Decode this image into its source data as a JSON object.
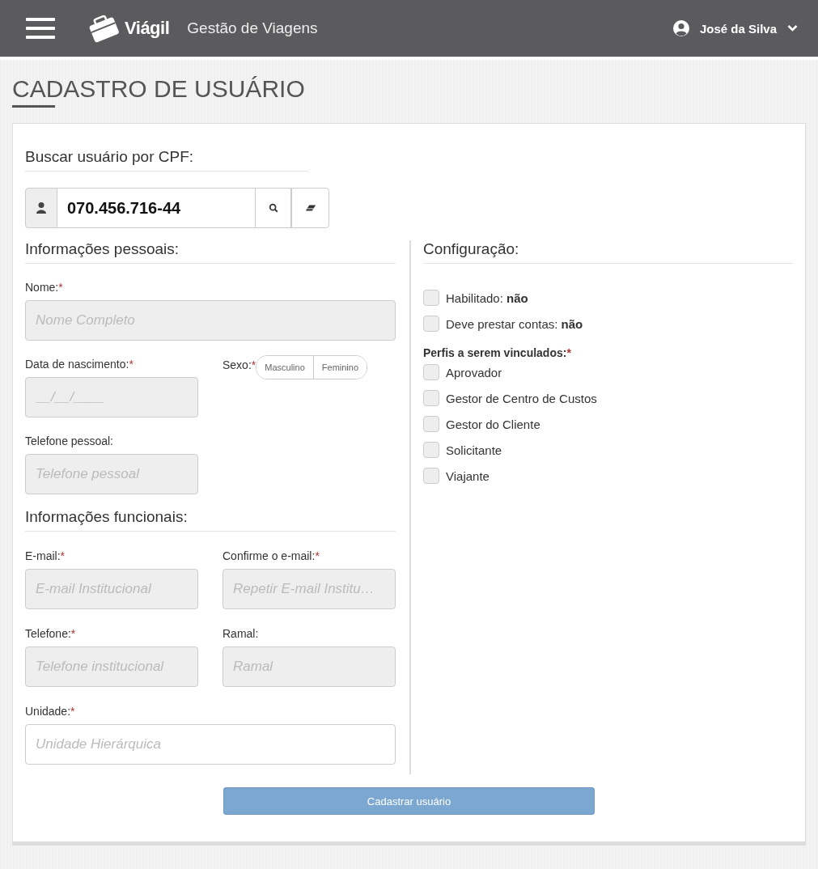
{
  "header": {
    "brand": "Viágil",
    "subtitle": "Gestão de Viagens",
    "user": "José da Silva"
  },
  "page_title": "CADASTRO DE USUÁRIO",
  "search": {
    "heading": "Buscar usuário por CPF:",
    "value": "070.456.716-44"
  },
  "personal": {
    "heading": "Informações pessoais:",
    "name": {
      "label": "Nome:",
      "asterisk": "*",
      "placeholder": "Nome Completo",
      "disabled": true
    },
    "birth": {
      "label": "Data de nascimento:",
      "asterisk": "*",
      "placeholder": "__/__/____",
      "disabled": true
    },
    "sex": {
      "label": "Sexo:",
      "asterisk": "*",
      "options": [
        {
          "label": "Masculino",
          "selected": false
        },
        {
          "label": "Feminino",
          "selected": false
        }
      ]
    },
    "phone": {
      "label": "Telefone pessoal:",
      "placeholder": "Telefone pessoal",
      "disabled": true
    }
  },
  "work": {
    "heading": "Informações funcionais:",
    "fields": [
      {
        "label": "E-mail:",
        "asterisk": "*",
        "placeholder": "E-mail Institucional",
        "disabled": true
      },
      {
        "label": "Confirme o e-mail:",
        "asterisk": "*",
        "placeholder": "Repetir E-mail Institu…",
        "disabled": true
      },
      {
        "label": "Telefone:",
        "asterisk": "*",
        "placeholder": "Telefone institucional",
        "disabled": true
      },
      {
        "label": "Ramal:",
        "placeholder": "Ramal",
        "disabled": true
      },
      {
        "label": "Unidade:",
        "asterisk": "*",
        "placeholder": "Unidade Hierárquica",
        "disabled": false,
        "wide": true
      }
    ]
  },
  "config": {
    "heading": "Configuração:",
    "toggles": [
      {
        "label": "Habilitado: **não**",
        "checked": false
      },
      {
        "label": "Deve prestar contas: **não**",
        "checked": false
      }
    ],
    "profiles_heading": "Perfis a serem vinculados:",
    "profiles_asterisk": "*",
    "profiles": [
      {
        "label": "Aprovador",
        "checked": false
      },
      {
        "label": "Gestor de Centro de Custos",
        "checked": false
      },
      {
        "label": "Gestor do Cliente",
        "checked": false
      },
      {
        "label": "Solicitante",
        "checked": false
      },
      {
        "label": "Viajante",
        "checked": false
      }
    ]
  },
  "submit": "Cadastrar usuário"
}
